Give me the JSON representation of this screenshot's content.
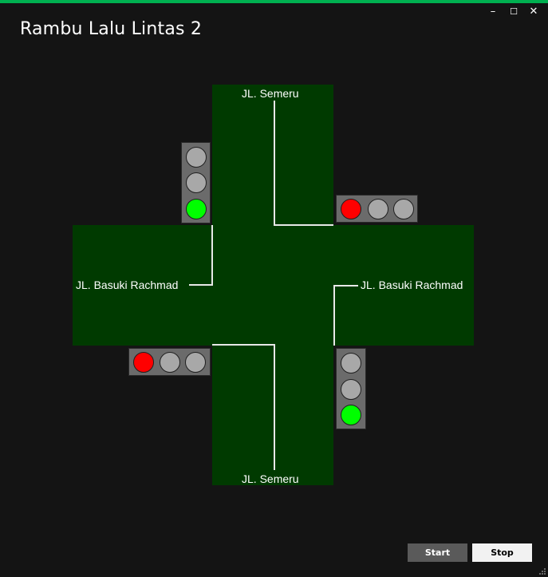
{
  "window": {
    "title": "Rambu Lalu Lintas 2",
    "accent_color": "#00b050",
    "controls": {
      "minimize": "–",
      "maximize": "☐",
      "close": "✕"
    }
  },
  "roads": {
    "north_label": "JL. Semeru",
    "south_label": "JL. Semeru",
    "west_label": "JL. Basuki Rachmad",
    "east_label": "JL. Basuki Rachmad",
    "road_color": "#003a00"
  },
  "traffic_lights": {
    "north_west": {
      "orientation": "vertical",
      "lamps": [
        "off",
        "off",
        "green"
      ]
    },
    "north_east": {
      "orientation": "horizontal",
      "lamps": [
        "red",
        "off",
        "off"
      ]
    },
    "south_west": {
      "orientation": "horizontal",
      "lamps": [
        "red",
        "off",
        "off"
      ]
    },
    "south_east": {
      "orientation": "vertical",
      "lamps": [
        "off",
        "off",
        "green"
      ]
    }
  },
  "buttons": {
    "start": "Start",
    "stop": "Stop"
  }
}
